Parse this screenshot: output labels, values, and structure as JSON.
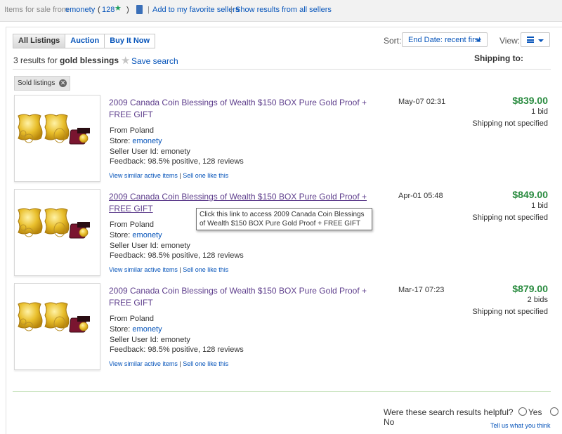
{
  "topbar": {
    "prefix": "Items for sale from",
    "seller": "emonety",
    "feedback_open": "(",
    "feedback_count": "128",
    "feedback_close": ")",
    "separator": "|",
    "add_favorite": "Add to my favorite sellers",
    "show_all": "Show results from all sellers"
  },
  "tabs": [
    "All Listings",
    "Auction",
    "Buy It Now"
  ],
  "sort": {
    "label": "Sort:",
    "value": "End Date: recent first"
  },
  "view": {
    "label": "View:"
  },
  "results": {
    "count_text": "3 results for",
    "query": "gold blessings"
  },
  "save_search": "Save search",
  "shipping_to": "Shipping to:",
  "filter_chip": "Sold listings",
  "items": [
    {
      "title": "2009 Canada Coin Blessings of Wealth $150 BOX Pure Gold Proof + FREE GIFT",
      "from": "From Poland",
      "store_label": "Store:",
      "store": "emonety",
      "seller": "Seller User Id: emonety",
      "feedback": "Feedback: 98.5% positive, 128 reviews",
      "similar": "View similar active items",
      "sep": "|",
      "sell": "Sell one like this",
      "date": "May-07 02:31",
      "price": "$839.00",
      "bids": "1 bid",
      "shipping": "Shipping not specified"
    },
    {
      "title": "2009 Canada Coin Blessings of Wealth $150 BOX Pure Gold Proof + FREE GIFT",
      "from": "From Poland",
      "store_label": "Store:",
      "store": "emonety",
      "seller": "Seller User Id: emonety",
      "feedback": "Feedback: 98.5% positive, 128 reviews",
      "similar": "View similar active items",
      "sep": "|",
      "sell": "Sell one like this",
      "date": "Apr-01 05:48",
      "price": "$849.00",
      "bids": "1 bid",
      "shipping": "Shipping not specified"
    },
    {
      "title": "2009 Canada Coin Blessings of Wealth $150 BOX Pure Gold Proof + FREE GIFT",
      "from": "From Poland",
      "store_label": "Store:",
      "store": "emonety",
      "seller": "Seller User Id: emonety",
      "feedback": "Feedback: 98.5% positive, 128 reviews",
      "similar": "View similar active items",
      "sep": "|",
      "sell": "Sell one like this",
      "date": "Mar-17 07:23",
      "price": "$879.00",
      "bids": "2 bids",
      "shipping": "Shipping not specified"
    }
  ],
  "tooltip": "Click this link to access 2009 Canada Coin Blessings of Wealth $150 BOX  Pure Gold Proof + FREE GIFT",
  "helpful": {
    "question": "Were these search results helpful?",
    "yes": "Yes",
    "no": "No"
  },
  "tell_us": "Tell us what you think",
  "colors": {
    "link": "#0654ba",
    "title_visited": "#5e3e8c",
    "price": "#298b3f",
    "star": "#1a9e5a"
  },
  "icons": {
    "feedback_star": "green-star-icon",
    "seller_doc": "document-icon",
    "save": "star-icon",
    "chip_close": "close-icon",
    "view": "list-view-icon"
  }
}
